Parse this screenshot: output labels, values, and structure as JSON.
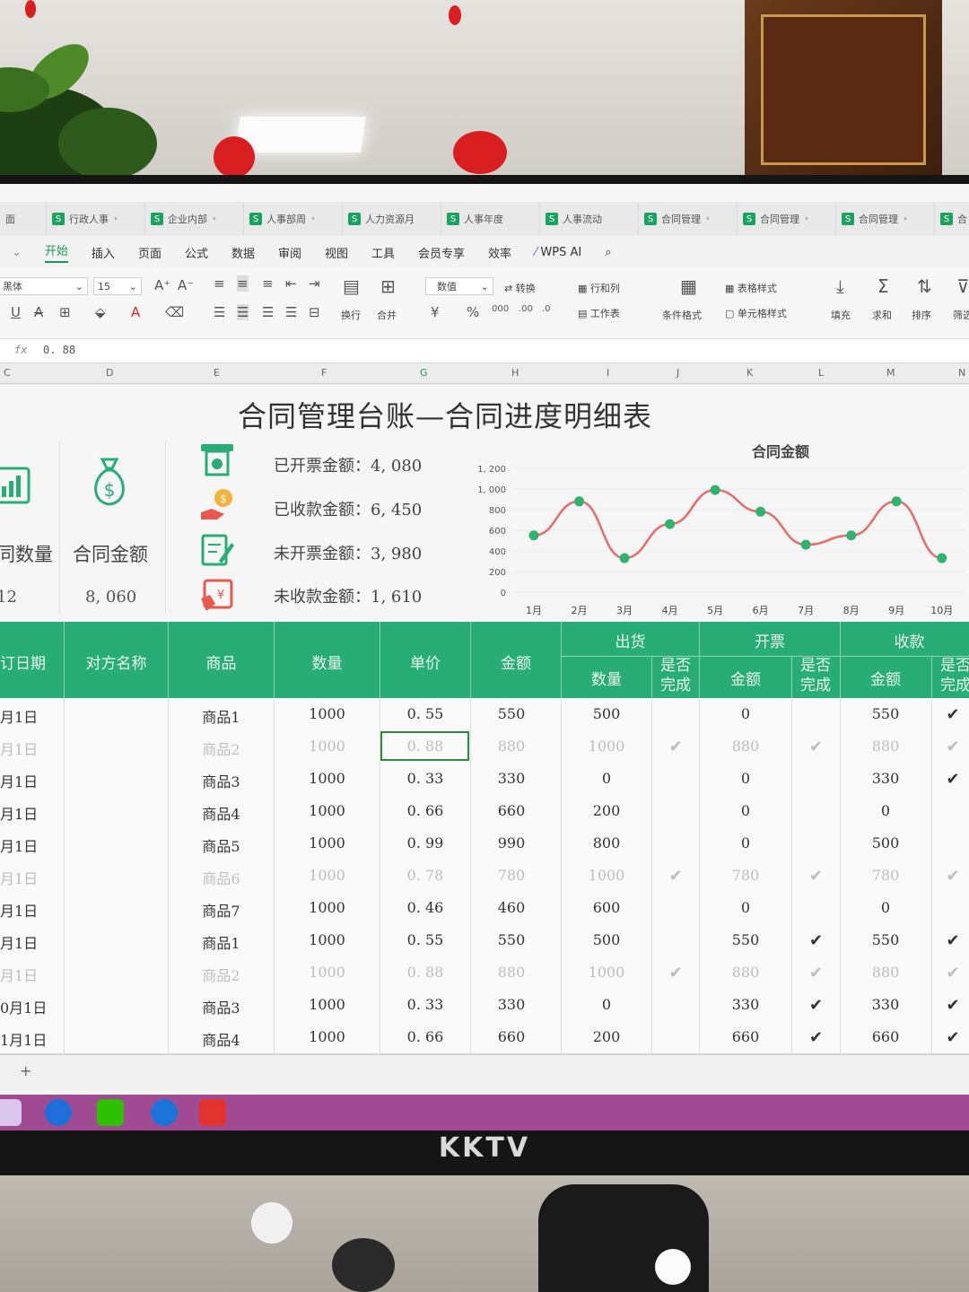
{
  "window": {
    "doc_tabs": [
      {
        "label": "面"
      },
      {
        "label": "行政人事"
      },
      {
        "label": "企业内部"
      },
      {
        "label": "人事部周"
      },
      {
        "label": "人力资源月"
      },
      {
        "label": "人事年度"
      },
      {
        "label": "人事流动"
      },
      {
        "label": "合同管理"
      },
      {
        "label": "合同管理"
      },
      {
        "label": "合同管理"
      },
      {
        "label": "合"
      }
    ]
  },
  "menu": {
    "items": [
      "开始",
      "插入",
      "页面",
      "公式",
      "数据",
      "审阅",
      "视图",
      "工具",
      "会员专享",
      "效率"
    ],
    "ai_label": "WPS AI"
  },
  "toolbar": {
    "font_name": "黑体",
    "font_size": "15",
    "number_format": "数值",
    "labels": {
      "wrap": "换行",
      "merge": "合并",
      "convert": "转换",
      "row_col": "行和列",
      "worksheet": "工作表",
      "cond_format": "条件格式",
      "table_style": "表格样式",
      "cell_style": "单元格样式",
      "fill": "填充",
      "sum": "求和",
      "sort": "排序",
      "filter": "筛选"
    }
  },
  "formula_bar": {
    "fx": "fx",
    "value": "0. 88"
  },
  "columns": [
    "C",
    "D",
    "E",
    "F",
    "G",
    "H",
    "I",
    "J",
    "K",
    "L",
    "M",
    "N"
  ],
  "dashboard": {
    "title": "合同管理台账—合同进度明细表",
    "kpis": [
      {
        "label": "同数量",
        "value": "12"
      },
      {
        "label": "合同金额",
        "value": "8, 060"
      }
    ],
    "stats": [
      {
        "label": "已开票金额：",
        "value": "4, 080"
      },
      {
        "label": "已收款金额：",
        "value": "6, 450"
      },
      {
        "label": "未开票金额：",
        "value": "3, 980"
      },
      {
        "label": "未收款金额：",
        "value": "1, 610"
      }
    ]
  },
  "chart_data": {
    "type": "line",
    "title": "合同金额",
    "categories": [
      "1月",
      "2月",
      "3月",
      "4月",
      "5月",
      "6月",
      "7月",
      "8月",
      "9月",
      "10月"
    ],
    "values": [
      550,
      880,
      330,
      660,
      990,
      780,
      460,
      550,
      880,
      330
    ],
    "ylim": [
      0,
      1200
    ],
    "yticks": [
      "0",
      "200",
      "400",
      "600",
      "800",
      "1, 000",
      "1, 200"
    ],
    "line_color": "#e86a6a",
    "marker_color": "#2fb36f"
  },
  "table": {
    "headers": {
      "date": "订日期",
      "party": "对方名称",
      "product": "商品",
      "qty": "数量",
      "price": "单价",
      "amount": "金额",
      "ship": "出货",
      "invoice": "开票",
      "receipt": "收款",
      "ship_qty": "数量",
      "done": "是否完成",
      "inv_amount": "金额",
      "rec_amount": "金额"
    },
    "rows": [
      {
        "date": "月1日",
        "product": "商品1",
        "qty": "1000",
        "price": "0. 55",
        "amount": "550",
        "ship_qty": "500",
        "ship_done": "",
        "inv": "0",
        "inv_done": "",
        "rec": "550",
        "rec_done": "✔",
        "faded": false
      },
      {
        "date": "月1日",
        "product": "商品2",
        "qty": "1000",
        "price": "0. 88",
        "amount": "880",
        "ship_qty": "1000",
        "ship_done": "✔",
        "inv": "880",
        "inv_done": "✔",
        "rec": "880",
        "rec_done": "✔",
        "faded": true
      },
      {
        "date": "月1日",
        "product": "商品3",
        "qty": "1000",
        "price": "0. 33",
        "amount": "330",
        "ship_qty": "0",
        "ship_done": "",
        "inv": "0",
        "inv_done": "",
        "rec": "330",
        "rec_done": "✔",
        "faded": false
      },
      {
        "date": "月1日",
        "product": "商品4",
        "qty": "1000",
        "price": "0. 66",
        "amount": "660",
        "ship_qty": "200",
        "ship_done": "",
        "inv": "0",
        "inv_done": "",
        "rec": "0",
        "rec_done": "",
        "faded": false
      },
      {
        "date": "月1日",
        "product": "商品5",
        "qty": "1000",
        "price": "0. 99",
        "amount": "990",
        "ship_qty": "800",
        "ship_done": "",
        "inv": "0",
        "inv_done": "",
        "rec": "500",
        "rec_done": "",
        "faded": false
      },
      {
        "date": "月1日",
        "product": "商品6",
        "qty": "1000",
        "price": "0. 78",
        "amount": "780",
        "ship_qty": "1000",
        "ship_done": "✔",
        "inv": "780",
        "inv_done": "✔",
        "rec": "780",
        "rec_done": "✔",
        "faded": true
      },
      {
        "date": "月1日",
        "product": "商品7",
        "qty": "1000",
        "price": "0. 46",
        "amount": "460",
        "ship_qty": "600",
        "ship_done": "",
        "inv": "0",
        "inv_done": "",
        "rec": "0",
        "rec_done": "",
        "faded": false
      },
      {
        "date": "月1日",
        "product": "商品1",
        "qty": "1000",
        "price": "0. 55",
        "amount": "550",
        "ship_qty": "500",
        "ship_done": "",
        "inv": "550",
        "inv_done": "✔",
        "rec": "550",
        "rec_done": "✔",
        "faded": false
      },
      {
        "date": "月1日",
        "product": "商品2",
        "qty": "1000",
        "price": "0. 88",
        "amount": "880",
        "ship_qty": "1000",
        "ship_done": "✔",
        "inv": "880",
        "inv_done": "✔",
        "rec": "880",
        "rec_done": "✔",
        "faded": true
      },
      {
        "date": "0月1日",
        "product": "商品3",
        "qty": "1000",
        "price": "0. 33",
        "amount": "330",
        "ship_qty": "0",
        "ship_done": "",
        "inv": "330",
        "inv_done": "✔",
        "rec": "330",
        "rec_done": "✔",
        "faded": false
      },
      {
        "date": "1月1日",
        "product": "商品4",
        "qty": "1000",
        "price": "0. 66",
        "amount": "660",
        "ship_qty": "200",
        "ship_done": "",
        "inv": "660",
        "inv_done": "✔",
        "rec": "660",
        "rec_done": "✔",
        "faded": false
      }
    ]
  },
  "sheet_tabs": {
    "add": "+"
  },
  "monitor": {
    "brand": "KKTV"
  }
}
